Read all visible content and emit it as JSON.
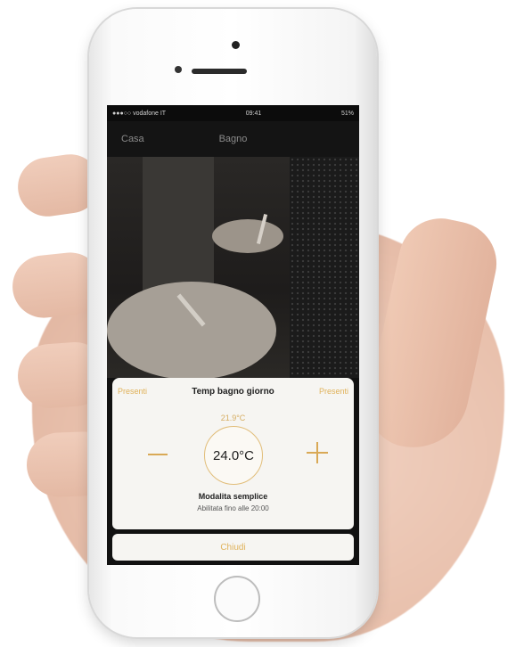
{
  "status_bar": {
    "carrier": "●●●○○ vodafone IT",
    "time": "09:41",
    "battery": "51%"
  },
  "nav": {
    "back_label": "Casa",
    "title": "Bagno"
  },
  "thermostat": {
    "left_action": "Presenti",
    "title": "Temp bagno giorno",
    "right_action": "Presenti",
    "current_temp": "21.9°C",
    "setpoint": "24.0°C",
    "mode_title": "Modalita semplice",
    "mode_subtitle": "Abilitata fino alle 20:00",
    "close_label": "Chiudi"
  },
  "colors": {
    "accent": "#e0b25a",
    "sheet_bg": "#f6f5f2"
  },
  "icons": {
    "minus": "minus-icon",
    "plus": "plus-icon"
  }
}
